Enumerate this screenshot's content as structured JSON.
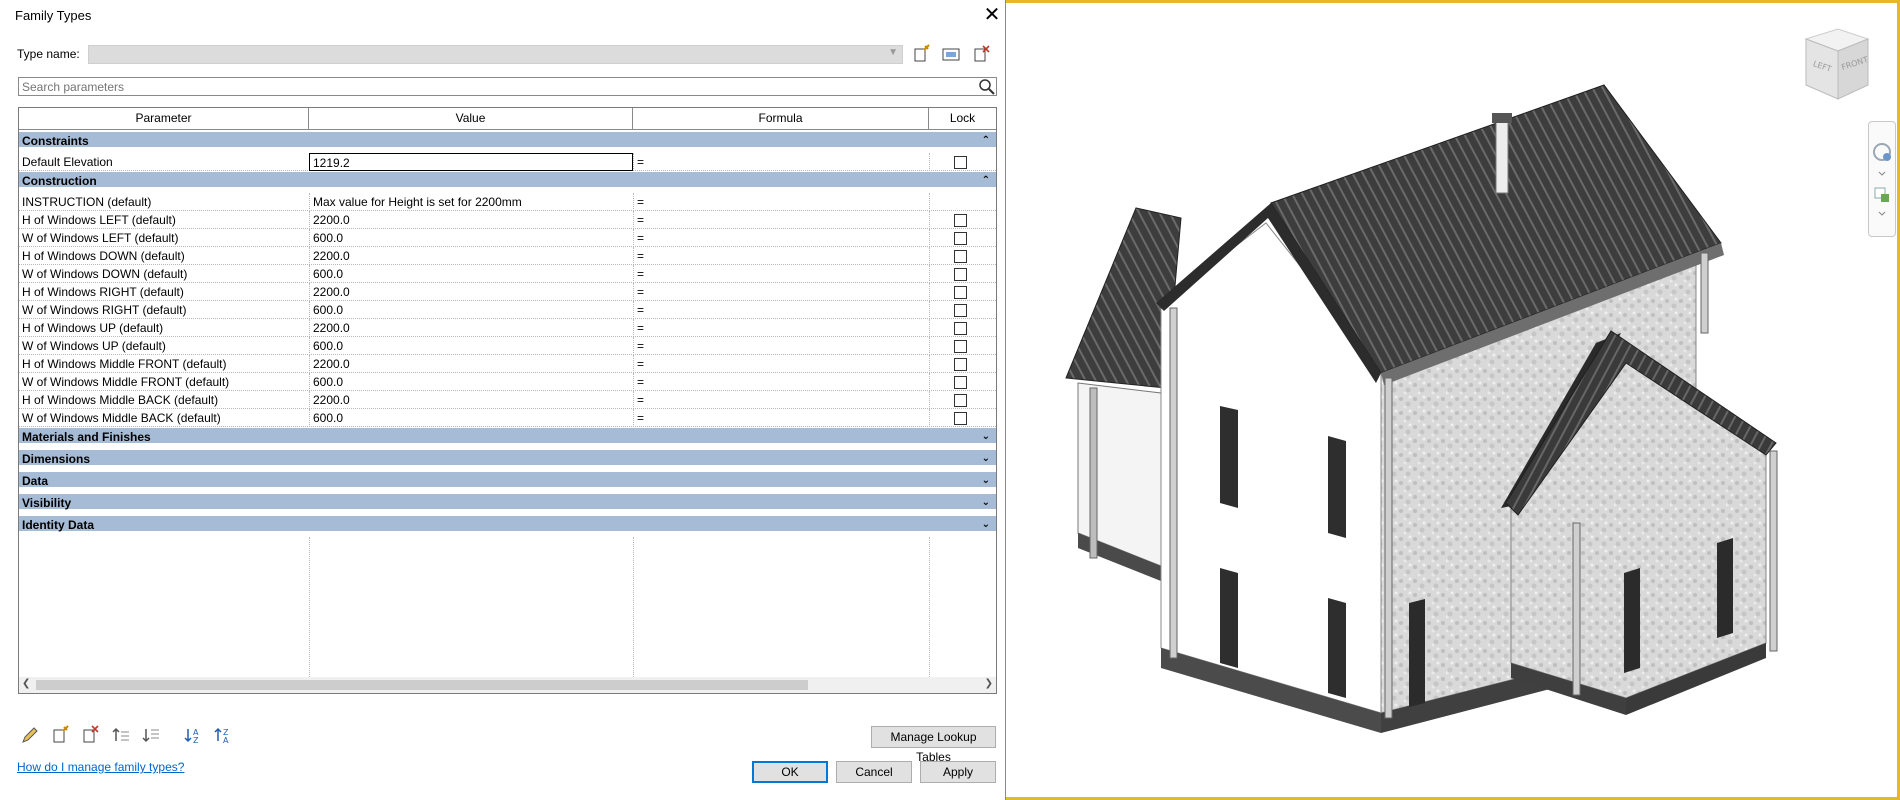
{
  "dialog": {
    "title": "Family Types",
    "type_name_label": "Type name:",
    "type_name_value": "",
    "search_placeholder": "Search parameters"
  },
  "grid": {
    "columns": [
      "Parameter",
      "Value",
      "Formula",
      "Lock"
    ],
    "constraints": {
      "label": "Constraints",
      "rows": [
        {
          "param": "Default Elevation",
          "value": "1219.2",
          "formula": "="
        }
      ]
    },
    "construction": {
      "label": "Construction",
      "rows": [
        {
          "param": "INSTRUCTION (default)",
          "value": "Max value for Height is set for 2200mm",
          "formula": "="
        },
        {
          "param": "H of Windows LEFT (default)",
          "value": "2200.0",
          "formula": "="
        },
        {
          "param": "W of Windows LEFT (default)",
          "value": "600.0",
          "formula": "="
        },
        {
          "param": "H of Windows DOWN (default)",
          "value": "2200.0",
          "formula": "="
        },
        {
          "param": "W of Windows DOWN (default)",
          "value": "600.0",
          "formula": "="
        },
        {
          "param": "H of Windows RIGHT (default)",
          "value": "2200.0",
          "formula": "="
        },
        {
          "param": "W of Windows RIGHT (default)",
          "value": "600.0",
          "formula": "="
        },
        {
          "param": "H of Windows  UP (default)",
          "value": "2200.0",
          "formula": "="
        },
        {
          "param": "W of Windows UP (default)",
          "value": "600.0",
          "formula": "="
        },
        {
          "param": "H of Windows Middle FRONT (default)",
          "value": "2200.0",
          "formula": "="
        },
        {
          "param": "W of Windows Middle FRONT (default)",
          "value": "600.0",
          "formula": "="
        },
        {
          "param": "H of Windows Middle BACK (default)",
          "value": "2200.0",
          "formula": "="
        },
        {
          "param": "W of Windows Middle BACK (default)",
          "value": "600.0",
          "formula": "="
        }
      ]
    },
    "collapsed_groups": [
      "Materials and Finishes",
      "Dimensions",
      "Data",
      "Visibility",
      "Identity Data"
    ]
  },
  "buttons": {
    "manage_lookup": "Manage Lookup Tables",
    "ok": "OK",
    "cancel": "Cancel",
    "apply": "Apply"
  },
  "help_link": "How do I manage family types?",
  "viewcube": {
    "left": "LEFT",
    "front": "FRONT"
  },
  "colors": {
    "group_header": "#a6bcd6",
    "viewport_border": "#e4b82a",
    "link": "#0066cc"
  }
}
